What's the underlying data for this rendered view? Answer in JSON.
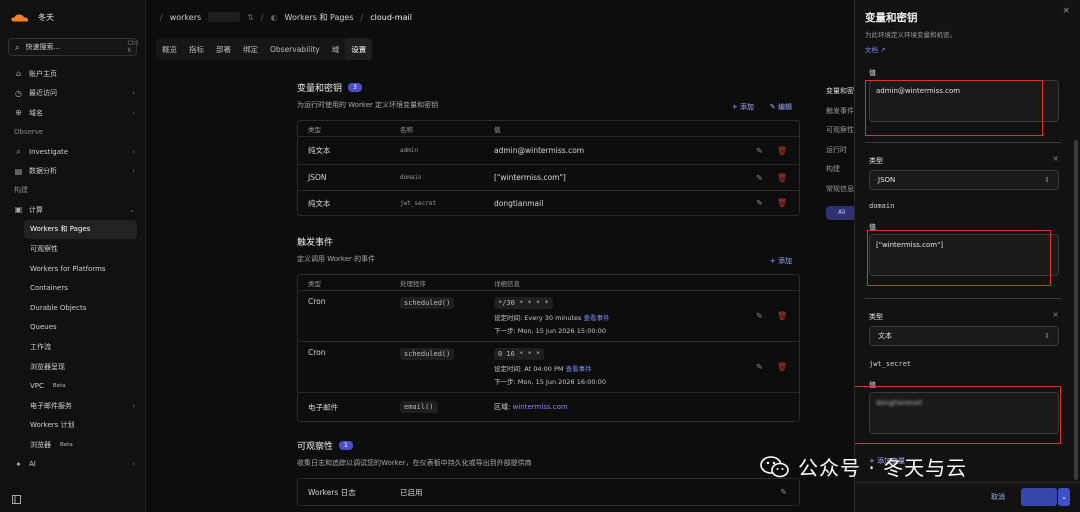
{
  "account": {
    "name": "冬天"
  },
  "search": {
    "placeholder": "快速搜索...",
    "shortcut": "Ctrl K"
  },
  "sidebar": {
    "top_items": [
      {
        "label": "账户主页",
        "icon": "home-icon"
      },
      {
        "label": "最近访问",
        "icon": "clock-icon"
      },
      {
        "label": "域名",
        "icon": "globe-icon"
      }
    ],
    "section_observe": "Observe",
    "observe_items": [
      {
        "label": "Investigate",
        "icon": "search-icon"
      },
      {
        "label": "数据分析",
        "icon": "chart-icon"
      }
    ],
    "section_build": "构建",
    "compute": {
      "label": "计算",
      "icon": "compute-icon"
    },
    "compute_items": [
      {
        "label": "Workers 和 Pages",
        "active": true
      },
      {
        "label": "可观察性"
      },
      {
        "label": "Workers for Platforms"
      },
      {
        "label": "Containers"
      },
      {
        "label": "Durable Objects"
      },
      {
        "label": "Queues"
      },
      {
        "label": "工作流"
      },
      {
        "label": "浏览器呈现"
      },
      {
        "label": "VPC",
        "badge": "Beta"
      },
      {
        "label": "电子邮件服务"
      },
      {
        "label": "Workers 计划"
      },
      {
        "label": "浏览器",
        "badge": "Beta"
      }
    ],
    "ai": {
      "label": "AI",
      "icon": "ai-icon"
    }
  },
  "breadcrumb": {
    "workers": "workers",
    "section": "Workers 和 Pages",
    "project": "cloud-mail"
  },
  "tabs": [
    "概览",
    "指标",
    "部署",
    "绑定",
    "Observability",
    "域",
    "设置"
  ],
  "variables": {
    "title": "变量和密钥",
    "count": "3",
    "desc": "为运行时使用的 Worker 定义环境变量和密钥",
    "add": "+ 添加",
    "edit": "编辑",
    "headers": [
      "类型",
      "名称",
      "值"
    ],
    "rows": [
      {
        "type": "纯文本",
        "name": "admin",
        "value": "admin@wintermiss.com"
      },
      {
        "type": "JSON",
        "name": "domain",
        "value": "[\"wintermiss.com\"]"
      },
      {
        "type": "纯文本",
        "name": "jwt_secret",
        "value": "dongtianmail"
      }
    ]
  },
  "triggers": {
    "title": "触发事件",
    "desc": "定义调用 Worker 的事件",
    "add": "+ 添加",
    "headers": [
      "类型",
      "处理程序",
      "详细信息"
    ],
    "rows": [
      {
        "type": "Cron",
        "handler": "scheduled()",
        "expr": "*/30 * * * *",
        "setting": "设定时间: Every 30 minutes",
        "link": "查看事件",
        "next": "下一步: Mon, 15 Jun 2026 15:00:00"
      },
      {
        "type": "Cron",
        "handler": "scheduled()",
        "expr": "0 16 * * *",
        "setting": "设定时间: At 04:00 PM",
        "link": "查看事件",
        "next": "下一步: Mon, 15 Jun 2026 16:00:00"
      }
    ],
    "email": {
      "type": "电子邮件",
      "handler": "email()",
      "domain_label": "区域:",
      "domain": "wintermiss.com"
    }
  },
  "observability": {
    "title": "可观察性",
    "count": "1",
    "desc": "收集日志和追踪以调试您的Worker，在仪表板中持久化或导出到外部提供商",
    "row_label": "Workers 日志",
    "row_status": "已启用"
  },
  "toc": {
    "items": [
      "变量和密钥",
      "触发事件",
      "可观察性",
      "运行时",
      "构建",
      "常规信息"
    ],
    "pill": "Ali"
  },
  "drawer": {
    "title": "变量和密钥",
    "subtitle": "为此环境定义环境变量和机密。",
    "doc_link": "文档",
    "value_label": "值",
    "type_label": "类型",
    "entries": [
      {
        "value": "admin@wintermiss.com"
      },
      {
        "type": "JSON",
        "name": "domain",
        "value": "[\"wintermiss.com\"]"
      },
      {
        "type": "文本",
        "name": "jwt_secret",
        "value": "dongtianmail"
      }
    ],
    "add_var": "+ 添加变量",
    "cancel": "取消"
  },
  "watermark": {
    "text": "公众号 · 冬天与云",
    "icon": "wechat-icon"
  },
  "colors": {
    "accent": "#7b8cff",
    "danger": "#c9362f",
    "highlight": "#e3312a",
    "badge": "#4a4fc9"
  }
}
